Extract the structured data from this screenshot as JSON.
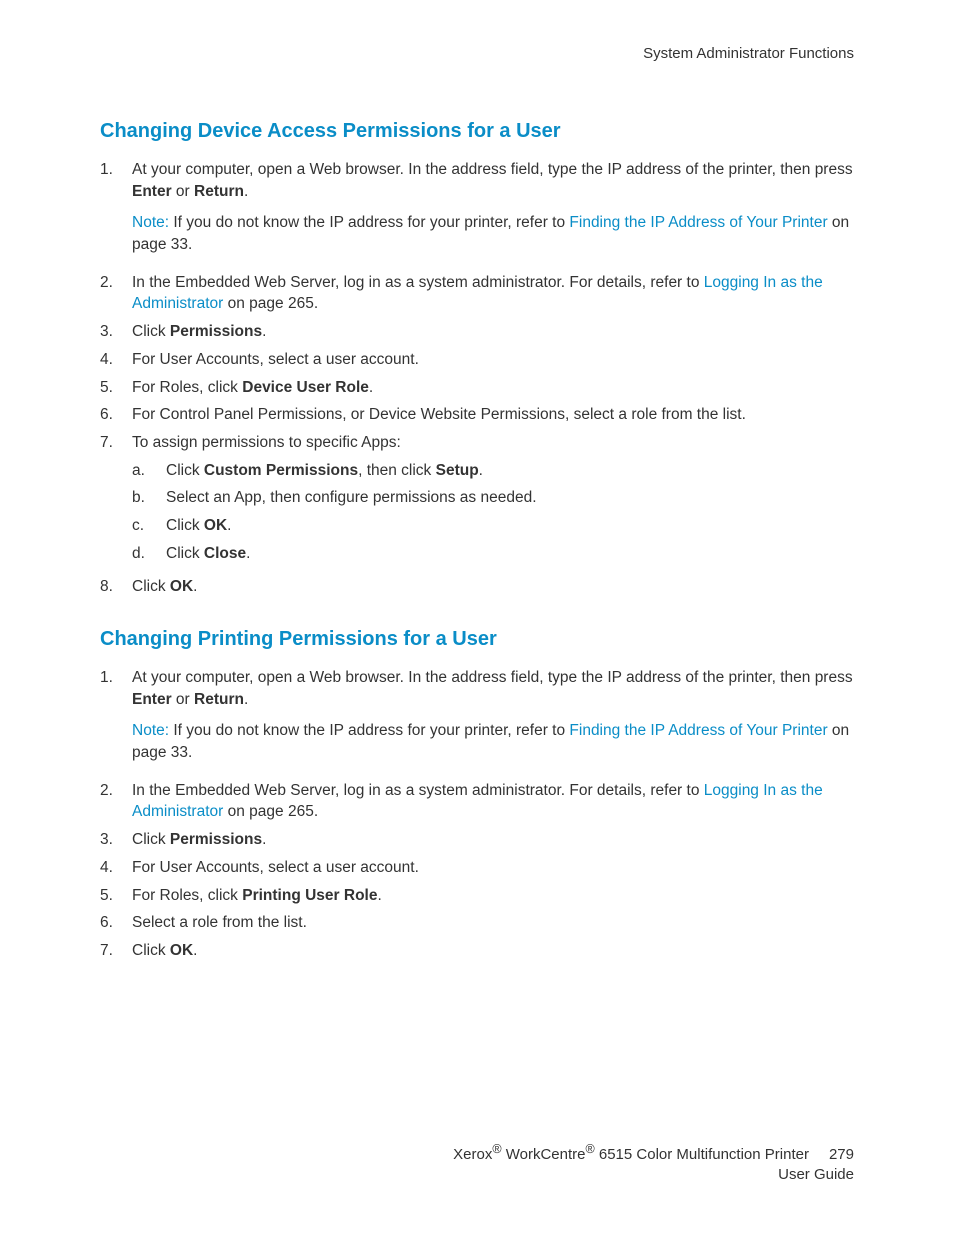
{
  "header": {
    "chapter": "System Administrator Functions"
  },
  "section1": {
    "heading": "Changing Device Access Permissions for a User",
    "step1_pre": "At your computer, open a Web browser. In the address field, type the IP address of the printer, then press ",
    "step1_bold1": "Enter",
    "step1_mid": " or ",
    "step1_bold2": "Return",
    "step1_end": ".",
    "note_label": "Note:",
    "note_pre": " If you do not know the IP address for your printer, refer to ",
    "note_link": "Finding the IP Address of Your Printer",
    "note_end": " on page 33.",
    "step2_pre": "In the Embedded Web Server, log in as a system administrator. For details, refer to ",
    "step2_link": "Logging In as the Administrator",
    "step2_end": " on page 265.",
    "step3_pre": "Click ",
    "step3_bold": "Permissions",
    "step3_end": ".",
    "step4": "For User Accounts, select a user account.",
    "step5_pre": "For Roles, click ",
    "step5_bold": "Device User Role",
    "step5_end": ".",
    "step6": "For Control Panel Permissions, or Device Website Permissions, select a role from the list.",
    "step7": "To assign permissions to specific Apps:",
    "step7a_pre": "Click ",
    "step7a_bold1": "Custom Permissions",
    "step7a_mid": ", then click ",
    "step7a_bold2": "Setup",
    "step7a_end": ".",
    "step7b": "Select an App, then configure permissions as needed.",
    "step7c_pre": "Click ",
    "step7c_bold": "OK",
    "step7c_end": ".",
    "step7d_pre": "Click ",
    "step7d_bold": "Close",
    "step7d_end": ".",
    "step8_pre": "Click ",
    "step8_bold": "OK",
    "step8_end": "."
  },
  "section2": {
    "heading": "Changing Printing Permissions for a User",
    "step1_pre": "At your computer, open a Web browser. In the address field, type the IP address of the printer, then press ",
    "step1_bold1": "Enter",
    "step1_mid": " or ",
    "step1_bold2": "Return",
    "step1_end": ".",
    "note_label": "Note:",
    "note_pre": " If you do not know the IP address for your printer, refer to ",
    "note_link": "Finding the IP Address of Your Printer",
    "note_end": " on page 33.",
    "step2_pre": "In the Embedded Web Server, log in as a system administrator. For details, refer to ",
    "step2_link": "Logging In as the Administrator",
    "step2_end": " on page 265.",
    "step3_pre": "Click ",
    "step3_bold": "Permissions",
    "step3_end": ".",
    "step4": "For User Accounts, select a user account.",
    "step5_pre": "For Roles, click ",
    "step5_bold": "Printing User Role",
    "step5_end": ".",
    "step6": "Select a role from the list.",
    "step7_pre": "Click ",
    "step7_bold": "OK",
    "step7_end": "."
  },
  "footer": {
    "brand1": "Xerox",
    "reg1": "®",
    "brand2": " WorkCentre",
    "reg2": "®",
    "product": " 6515 Color Multifunction Printer",
    "page_num": "279",
    "line2": "User Guide"
  },
  "markers": {
    "n1": "1.",
    "n2": "2.",
    "n3": "3.",
    "n4": "4.",
    "n5": "5.",
    "n6": "6.",
    "n7": "7.",
    "n8": "8.",
    "a": "a.",
    "b": "b.",
    "c": "c.",
    "d": "d."
  }
}
